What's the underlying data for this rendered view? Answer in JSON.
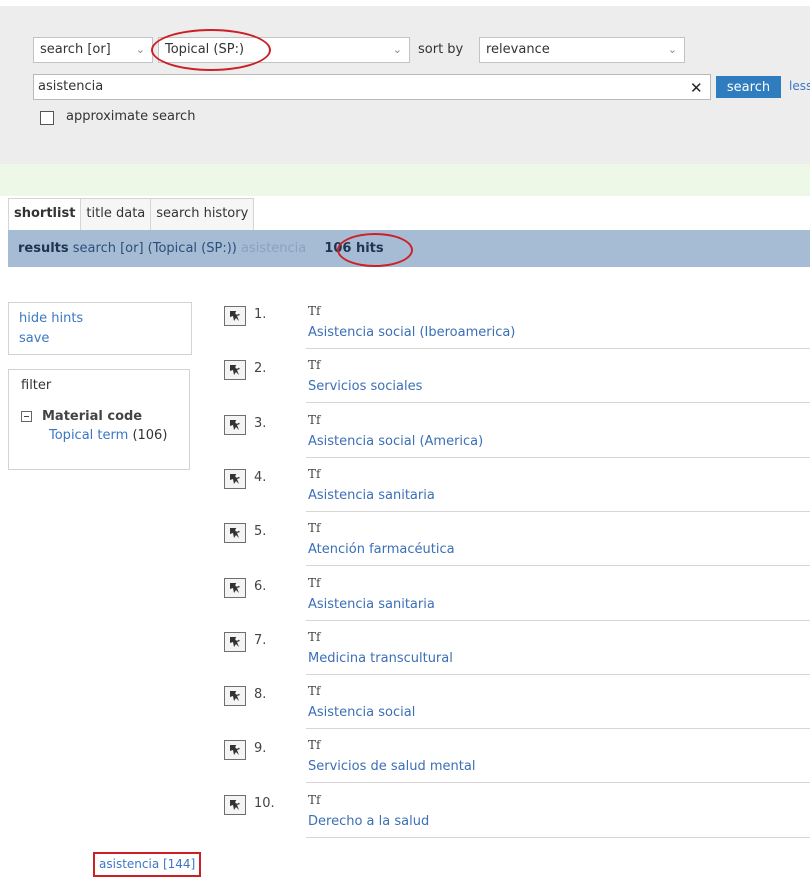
{
  "search": {
    "operator_select": "search [or]",
    "index_select": "Topical (SP:)",
    "sort_label": "sort by",
    "sort_select": "relevance",
    "query_value": "asistencia",
    "search_button": "search",
    "less_link": "less",
    "approximate_label": "approximate search",
    "approximate_checked": false
  },
  "tabs": [
    {
      "label": "shortlist",
      "active": true
    },
    {
      "label": "title data",
      "active": false
    },
    {
      "label": "search history",
      "active": false
    }
  ],
  "results_bar": {
    "label": "results",
    "query": "search [or] (Topical (SP:))",
    "term": "asistencia",
    "hits": "106 hits"
  },
  "sidebar": {
    "hide_hints": "hide hints",
    "save": "save",
    "filter_title": "filter",
    "group_label": "Material code",
    "item_label": "Topical term",
    "item_count": "(106)"
  },
  "results": [
    {
      "num": "1.",
      "code": "Tf",
      "title": "Asistencia social (Iberoamerica)"
    },
    {
      "num": "2.",
      "code": "Tf",
      "title": "Servicios sociales"
    },
    {
      "num": "3.",
      "code": "Tf",
      "title": "Asistencia social (America)"
    },
    {
      "num": "4.",
      "code": "Tf",
      "title": "Asistencia sanitaria"
    },
    {
      "num": "5.",
      "code": "Tf",
      "title": "Atención farmacéutica"
    },
    {
      "num": "6.",
      "code": "Tf",
      "title": "Asistencia sanitaria"
    },
    {
      "num": "7.",
      "code": "Tf",
      "title": "Medicina transcultural"
    },
    {
      "num": "8.",
      "code": "Tf",
      "title": "Asistencia social"
    },
    {
      "num": "9.",
      "code": "Tf",
      "title": "Servicios de salud mental"
    },
    {
      "num": "10.",
      "code": "Tf",
      "title": "Derecho a la salud"
    }
  ],
  "term_link": "asistencia [144]",
  "icons": {
    "record": "record-icon",
    "chevron": "chevron-down-icon",
    "clear": "clear-icon"
  },
  "colors": {
    "accent": "#2f7dbf",
    "link": "#3b78c4",
    "results_bar": "#a6bcd4",
    "highlight": "#cc1f27"
  }
}
